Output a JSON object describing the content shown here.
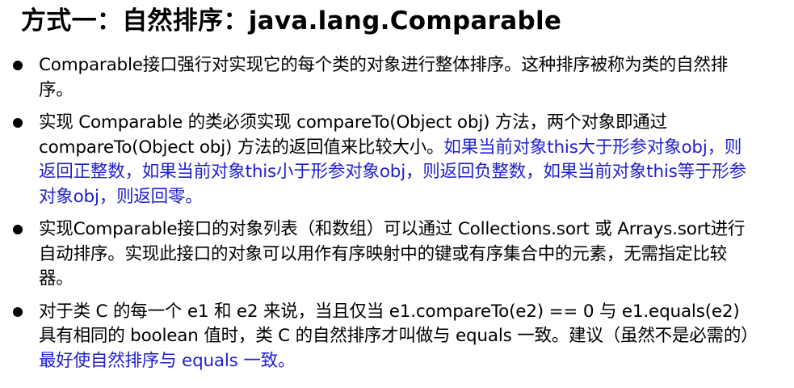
{
  "title": "方式一：自然排序：java.lang.Comparable",
  "accent_color": "#1f1fd2",
  "bullets": [
    {
      "text": "Comparable接口强行对实现它的每个类的对象进行整体排序。这种排序被称为类的自然排序。"
    },
    {
      "text": "实现 Comparable 的类必须实现 compareTo(Object obj) 方法，两个对象即通过 compareTo(Object obj) 方法的返回值来比较大小。",
      "highlight": "如果当前对象this大于形参对象obj，则返回正整数，如果当前对象this小于形参对象obj，则返回负整数，如果当前对象this等于形参对象obj，则返回零。"
    },
    {
      "text": "实现Comparable接口的对象列表（和数组）可以通过 Collections.sort 或 Arrays.sort进行自动排序。实现此接口的对象可以用作有序映射中的键或有序集合中的元素，无需指定比较器。"
    },
    {
      "text": "对于类 C 的每一个 e1 和 e2 来说，当且仅当 e1.compareTo(e2) == 0 与 e1.equals(e2) 具有相同的 boolean 值时，类 C 的自然排序才叫做与 equals 一致。建议（虽然不是必需的）",
      "highlight": "最好使自然排序与 equals 一致。"
    }
  ]
}
